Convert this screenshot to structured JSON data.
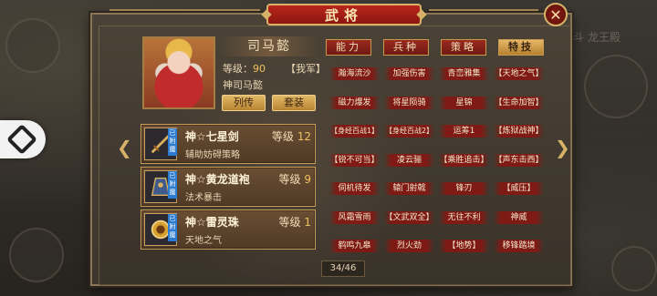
{
  "title": "武将",
  "close_label": "✕",
  "hero": {
    "name": "司马懿",
    "level_label": "等级：",
    "level_value": "90",
    "faction": "【我军】",
    "full_name": "神司马懿",
    "buttons": [
      "列传",
      "套装"
    ]
  },
  "equipment": [
    {
      "name": "神☆七星剑",
      "level_label": "等级",
      "level": "12",
      "desc": "辅助妨碍策略",
      "tag": "已附魔",
      "icon": "sword-icon"
    },
    {
      "name": "神☆黄龙道袍",
      "level_label": "等级",
      "level": "9",
      "desc": "法术暴击",
      "tag": "已附魔",
      "icon": "robe-icon"
    },
    {
      "name": "神☆雷灵珠",
      "level_label": "等级",
      "level": "1",
      "desc": "天地之气",
      "tag": "已附魔",
      "icon": "orb-icon"
    }
  ],
  "tabs": [
    "能力",
    "兵种",
    "策略",
    "特技"
  ],
  "active_tab": "特技",
  "skills": [
    [
      "瀚海流沙",
      "加强伤害",
      "青峦雅集",
      "【天地之气】"
    ],
    [
      "磁力爆发",
      "将星陨骑",
      "星锦",
      "【生命加智】"
    ],
    [
      "【身经百战1】",
      "【身经百战2】",
      "运筹1",
      "【炼狱战神】"
    ],
    [
      "【锐不可当】",
      "凌云骊",
      "【乘胜追击】",
      "【声东击西】"
    ],
    [
      "伺机待发",
      "辕门射戟",
      "锋刃",
      "【威压】"
    ],
    [
      "风霜雪雨",
      "【文武双全】",
      "无往不利",
      "神威"
    ],
    [
      "鹤鸣九皋",
      "烈火劲",
      "【地势】",
      "移锋踏境"
    ]
  ],
  "page": "34/46",
  "bg_text": "斗 龙王殿",
  "colors": {
    "accent_red": "#9a2a1e",
    "gold": "#d9b26a"
  }
}
